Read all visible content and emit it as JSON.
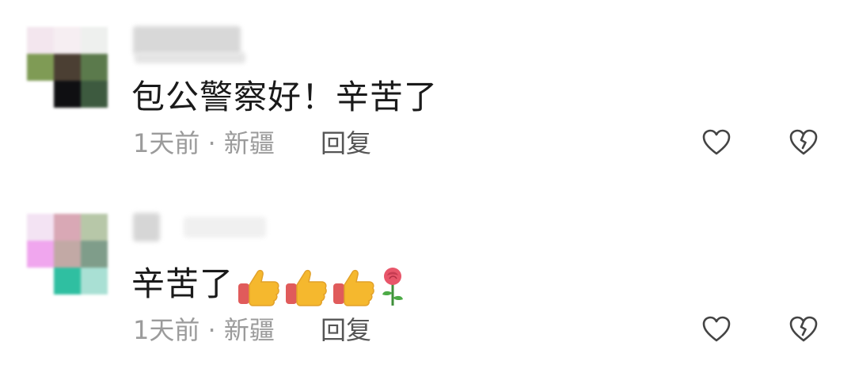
{
  "comments": [
    {
      "text": "包公警察好！辛苦了",
      "time": "1天前",
      "sep": " · ",
      "location": "新疆",
      "reply_label": "回复",
      "emojis": []
    },
    {
      "text": "辛苦了",
      "time": "1天前",
      "sep": " · ",
      "location": "新疆",
      "reply_label": "回复",
      "emojis": [
        "thumbs-up",
        "thumbs-up",
        "thumbs-up",
        "rose"
      ]
    }
  ],
  "colors": {
    "text": "#1a1a1a",
    "meta": "#9b9b9b",
    "reply": "#555555",
    "icon_stroke": "#444444"
  }
}
